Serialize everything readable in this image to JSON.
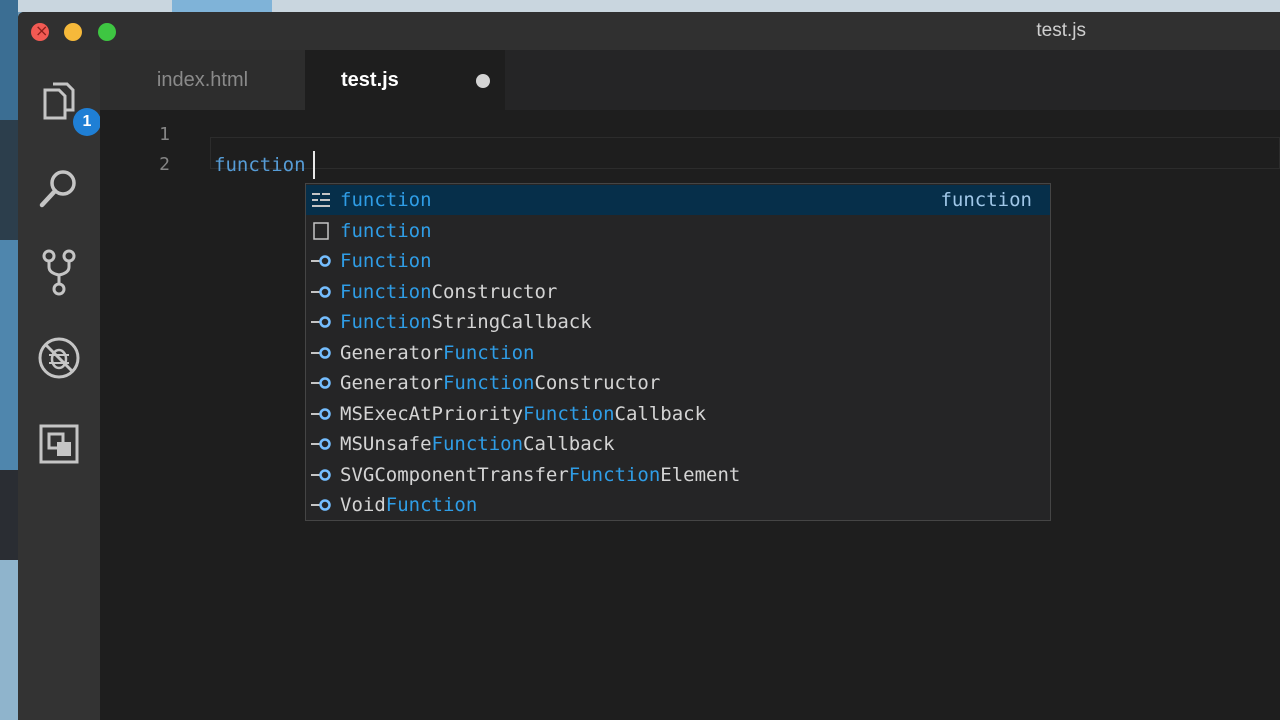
{
  "window": {
    "title": "test.js"
  },
  "activity_bar": {
    "explorer_badge": "1"
  },
  "tabs": [
    {
      "label": "index.html",
      "active": false
    },
    {
      "label": "test.js",
      "active": true,
      "dirty": true
    }
  ],
  "editor": {
    "line_numbers": [
      "1",
      "2"
    ],
    "lines": [
      "",
      "function"
    ]
  },
  "suggest": {
    "query": "function",
    "items": [
      {
        "kind": "snippet",
        "prefix": "",
        "match": "function",
        "suffix": "",
        "detail": "function",
        "selected": true
      },
      {
        "kind": "keyword",
        "prefix": "",
        "match": "function",
        "suffix": ""
      },
      {
        "kind": "variable",
        "prefix": "",
        "match": "Function",
        "suffix": ""
      },
      {
        "kind": "variable",
        "prefix": "",
        "match": "Function",
        "suffix": "Constructor"
      },
      {
        "kind": "variable",
        "prefix": "",
        "match": "Function",
        "suffix": "StringCallback"
      },
      {
        "kind": "variable",
        "prefix": "Generator",
        "match": "Function",
        "suffix": ""
      },
      {
        "kind": "variable",
        "prefix": "Generator",
        "match": "Function",
        "suffix": "Constructor"
      },
      {
        "kind": "variable",
        "prefix": "MSExecAtPriority",
        "match": "Function",
        "suffix": "Callback"
      },
      {
        "kind": "variable",
        "prefix": "MSUnsafe",
        "match": "Function",
        "suffix": "Callback"
      },
      {
        "kind": "variable",
        "prefix": "SVGComponentTransfer",
        "match": "Function",
        "suffix": "Element"
      },
      {
        "kind": "variable",
        "prefix": "Void",
        "match": "Function",
        "suffix": ""
      }
    ]
  },
  "colors": {
    "editor_bg": "#1e1e1e",
    "keyword": "#569cd6",
    "match_highlight": "#2f9de6",
    "selection_bg": "#062f4a",
    "badge": "#1f7fd5"
  }
}
